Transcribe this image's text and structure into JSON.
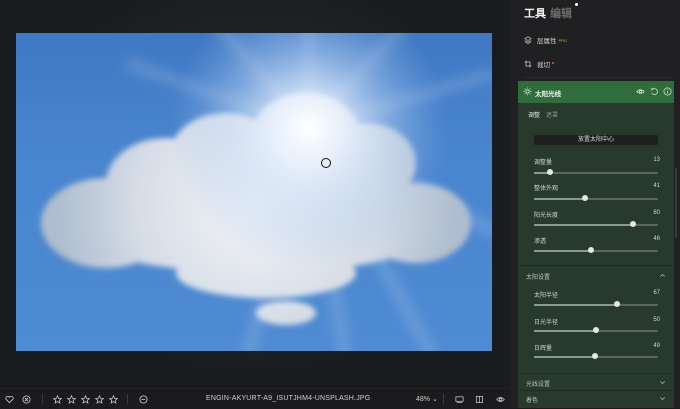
{
  "bottom_bar": {
    "filename": "ENGIN-AKYURT-A9_ISUTJHM4-UNSPLASH.JPG",
    "zoom": "48%",
    "rating_stars": 5,
    "icons": [
      "heart-icon",
      "reject-icon",
      "star-icon",
      "star-icon",
      "star-icon",
      "star-icon",
      "star-icon",
      "minus-circle-icon",
      "compare-icon",
      "split-view-icon",
      "preview-eye-icon"
    ]
  },
  "panel": {
    "tabs": {
      "tools": "工具",
      "edit": "编辑"
    },
    "layer_properties": {
      "label": "层属性",
      "badge": "PRO"
    },
    "crop": {
      "label": "裁切"
    },
    "effect": {
      "title": "太阳光线",
      "sub_tabs": {
        "adjust": "调整",
        "mask": "遮罩"
      },
      "place_sun_button": "放置太阳中心",
      "sliders": [
        {
          "label": "调整量",
          "value": "13"
        },
        {
          "label": "整体外观",
          "value": "41"
        },
        {
          "label": "阳光长度",
          "value": "80"
        },
        {
          "label": "渗透",
          "value": "46"
        }
      ],
      "sun_settings": {
        "title": "太阳设置",
        "sliders": [
          {
            "label": "太阳半径",
            "value": "67"
          },
          {
            "label": "日光半径",
            "value": "50"
          },
          {
            "label": "日辉量",
            "value": "49"
          }
        ]
      },
      "ray_settings": {
        "title": "光线设置"
      },
      "color": {
        "title": "着色"
      }
    }
  },
  "colors": {
    "accent_header": "#2f6e3b",
    "effect_bg": "#283a2c",
    "sky": "#4a86cf"
  }
}
